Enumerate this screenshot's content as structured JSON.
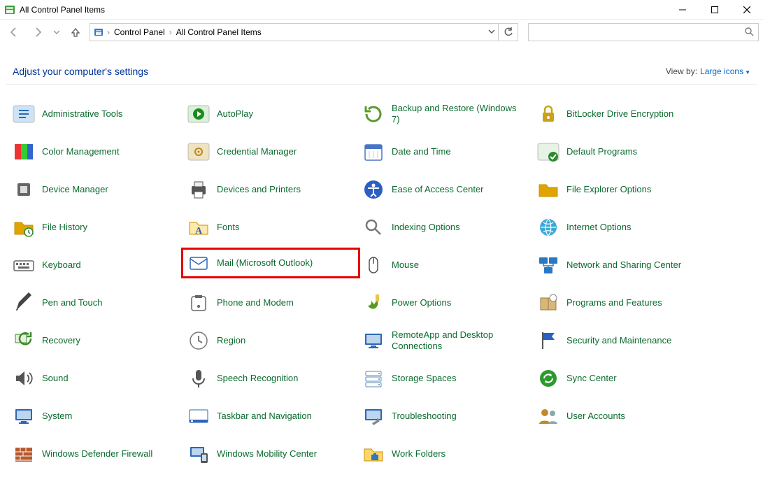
{
  "window": {
    "title": "All Control Panel Items"
  },
  "breadcrumb": {
    "root": "Control Panel",
    "current": "All Control Panel Items"
  },
  "search": {
    "placeholder": ""
  },
  "header": {
    "heading": "Adjust your computer's settings",
    "view_by_label": "View by:",
    "view_by_value": "Large icons"
  },
  "items": [
    {
      "id": "administrative-tools",
      "label": "Administrative Tools"
    },
    {
      "id": "autoplay",
      "label": "AutoPlay"
    },
    {
      "id": "backup-restore",
      "label": "Backup and Restore (Windows 7)"
    },
    {
      "id": "bitlocker",
      "label": "BitLocker Drive Encryption"
    },
    {
      "id": "color-management",
      "label": "Color Management"
    },
    {
      "id": "credential-manager",
      "label": "Credential Manager"
    },
    {
      "id": "date-time",
      "label": "Date and Time"
    },
    {
      "id": "default-programs",
      "label": "Default Programs"
    },
    {
      "id": "device-manager",
      "label": "Device Manager"
    },
    {
      "id": "devices-printers",
      "label": "Devices and Printers"
    },
    {
      "id": "ease-of-access",
      "label": "Ease of Access Center"
    },
    {
      "id": "file-explorer-options",
      "label": "File Explorer Options"
    },
    {
      "id": "file-history",
      "label": "File History"
    },
    {
      "id": "fonts",
      "label": "Fonts"
    },
    {
      "id": "indexing-options",
      "label": "Indexing Options"
    },
    {
      "id": "internet-options",
      "label": "Internet Options"
    },
    {
      "id": "keyboard",
      "label": "Keyboard"
    },
    {
      "id": "mail-outlook",
      "label": "Mail (Microsoft Outlook)",
      "highlighted": true
    },
    {
      "id": "mouse",
      "label": "Mouse"
    },
    {
      "id": "network-sharing",
      "label": "Network and Sharing Center"
    },
    {
      "id": "pen-touch",
      "label": "Pen and Touch"
    },
    {
      "id": "phone-modem",
      "label": "Phone and Modem"
    },
    {
      "id": "power-options",
      "label": "Power Options"
    },
    {
      "id": "programs-features",
      "label": "Programs and Features"
    },
    {
      "id": "recovery",
      "label": "Recovery"
    },
    {
      "id": "region",
      "label": "Region"
    },
    {
      "id": "remoteapp",
      "label": "RemoteApp and Desktop Connections"
    },
    {
      "id": "security-maintenance",
      "label": "Security and Maintenance"
    },
    {
      "id": "sound",
      "label": "Sound"
    },
    {
      "id": "speech-recognition",
      "label": "Speech Recognition"
    },
    {
      "id": "storage-spaces",
      "label": "Storage Spaces"
    },
    {
      "id": "sync-center",
      "label": "Sync Center"
    },
    {
      "id": "system",
      "label": "System"
    },
    {
      "id": "taskbar-navigation",
      "label": "Taskbar and Navigation"
    },
    {
      "id": "troubleshooting",
      "label": "Troubleshooting"
    },
    {
      "id": "user-accounts",
      "label": "User Accounts"
    },
    {
      "id": "windows-defender-firewall",
      "label": "Windows Defender Firewall"
    },
    {
      "id": "windows-mobility",
      "label": "Windows Mobility Center"
    },
    {
      "id": "work-folders",
      "label": "Work Folders"
    }
  ],
  "icons": {
    "administrative-tools": {
      "bg": "#cfe3f7",
      "fg": "#2a6bb0",
      "glyph": "tools"
    },
    "autoplay": {
      "bg": "#d9f0d9",
      "fg": "#1e8a1e",
      "glyph": "play"
    },
    "backup-restore": {
      "bg": "#e4f1dd",
      "fg": "#579b2f",
      "glyph": "refresh"
    },
    "bitlocker": {
      "bg": "#f6edc9",
      "fg": "#caa21a",
      "glyph": "lock"
    },
    "color-management": {
      "bg": "#ffffff",
      "fg": "#888",
      "glyph": "swatch"
    },
    "credential-manager": {
      "bg": "#efe3c2",
      "fg": "#b58a1c",
      "glyph": "safe"
    },
    "date-time": {
      "bg": "#e8eef7",
      "fg": "#4876c6",
      "glyph": "calendar"
    },
    "default-programs": {
      "bg": "#e6f3e6",
      "fg": "#2c8a2c",
      "glyph": "check"
    },
    "device-manager": {
      "bg": "#ececec",
      "fg": "#666",
      "glyph": "chip"
    },
    "devices-printers": {
      "bg": "#ececec",
      "fg": "#555",
      "glyph": "printer"
    },
    "ease-of-access": {
      "bg": "#dbe7fb",
      "fg": "#2b5fc2",
      "glyph": "access"
    },
    "file-explorer-options": {
      "bg": "#ffefc2",
      "fg": "#e0a400",
      "glyph": "folder"
    },
    "file-history": {
      "bg": "#ffefc2",
      "fg": "#e0a400",
      "glyph": "folderclock"
    },
    "fonts": {
      "bg": "#ffefc2",
      "fg": "#2b5fc2",
      "glyph": "fontA"
    },
    "indexing-options": {
      "bg": "#efefef",
      "fg": "#777",
      "glyph": "search"
    },
    "internet-options": {
      "bg": "#d9f0e8",
      "fg": "#1e8a6e",
      "glyph": "globe"
    },
    "keyboard": {
      "bg": "#eee",
      "fg": "#666",
      "glyph": "keyboard"
    },
    "mail-outlook": {
      "bg": "#e0eaf7",
      "fg": "#2e66b7",
      "glyph": "mail"
    },
    "mouse": {
      "bg": "#eee",
      "fg": "#555",
      "glyph": "mouse"
    },
    "network-sharing": {
      "bg": "#dfeffd",
      "fg": "#2a78c2",
      "glyph": "network"
    },
    "pen-touch": {
      "bg": "#efefef",
      "fg": "#444",
      "glyph": "pen"
    },
    "phone-modem": {
      "bg": "#efefef",
      "fg": "#666",
      "glyph": "phone"
    },
    "power-options": {
      "bg": "#e9f3dc",
      "fg": "#5a9a1f",
      "glyph": "power"
    },
    "programs-features": {
      "bg": "#efefef",
      "fg": "#777",
      "glyph": "box"
    },
    "recovery": {
      "bg": "#e4f1dd",
      "fg": "#3c8a2a",
      "glyph": "recover"
    },
    "region": {
      "bg": "#efefef",
      "fg": "#777",
      "glyph": "clock"
    },
    "remoteapp": {
      "bg": "#e5edf8",
      "fg": "#2e66b7",
      "glyph": "monitor"
    },
    "security-maintenance": {
      "bg": "#e3ecf9",
      "fg": "#2b5fc2",
      "glyph": "flag"
    },
    "sound": {
      "bg": "#efefef",
      "fg": "#555",
      "glyph": "speaker"
    },
    "speech-recognition": {
      "bg": "#efefef",
      "fg": "#555",
      "glyph": "mic"
    },
    "storage-spaces": {
      "bg": "#e8eef5",
      "fg": "#5a8ab8",
      "glyph": "drives"
    },
    "sync-center": {
      "bg": "#dff3df",
      "fg": "#2c9a2c",
      "glyph": "sync"
    },
    "system": {
      "bg": "#e5edf8",
      "fg": "#2e66b7",
      "glyph": "monitor"
    },
    "taskbar-navigation": {
      "bg": "#eef4fb",
      "fg": "#2e66b7",
      "glyph": "taskbar"
    },
    "troubleshooting": {
      "bg": "#e5edf8",
      "fg": "#2e66b7",
      "glyph": "wrench"
    },
    "user-accounts": {
      "bg": "#f1e8d5",
      "fg": "#c08a2a",
      "glyph": "users"
    },
    "windows-defender-firewall": {
      "bg": "#f3ddd6",
      "fg": "#b85a2e",
      "glyph": "firewall"
    },
    "windows-mobility": {
      "bg": "#e5edf8",
      "fg": "#2e66b7",
      "glyph": "mobility"
    },
    "work-folders": {
      "bg": "#ffefc2",
      "fg": "#2e78c2",
      "glyph": "folderwork"
    }
  }
}
